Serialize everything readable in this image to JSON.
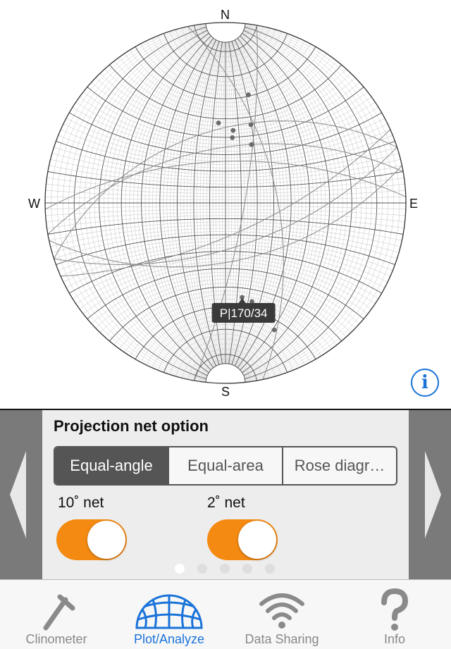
{
  "stereonet": {
    "directions": {
      "north": "N",
      "south": "S",
      "east": "E",
      "west": "W"
    },
    "tooltip": "P|170/34",
    "poles": [
      {
        "trend": 170,
        "plunge": 34
      },
      {
        "trend": 159,
        "plunge": 16
      },
      {
        "trend": 159,
        "plunge": 23
      },
      {
        "trend": 162,
        "plunge": 23
      },
      {
        "trend": 165,
        "plunge": 31
      },
      {
        "trend": 355,
        "plunge": 42
      },
      {
        "trend": 18,
        "plunge": 41
      },
      {
        "trend": 24,
        "plunge": 51
      },
      {
        "trend": 6,
        "plunge": 46
      },
      {
        "trend": 6,
        "plunge": 50
      },
      {
        "trend": 12,
        "plunge": 27
      }
    ],
    "planes": [
      {
        "strike": 72,
        "dip": 62
      },
      {
        "strike": 66,
        "dip": 70
      },
      {
        "strike": 78,
        "dip": 54
      },
      {
        "strike": 252,
        "dip": 46
      },
      {
        "strike": 260,
        "dip": 56
      },
      {
        "strike": 268,
        "dip": 64
      },
      {
        "strike": 348,
        "dip": 58
      },
      {
        "strike": 10,
        "dip": 78
      }
    ],
    "colors": {
      "grid": "#bdbdbd",
      "major_grid": "#555555",
      "planes": "#8a8a8a",
      "poles": "#6a6a6a",
      "outline": "#333333"
    }
  },
  "info_button": {
    "glyph": "i",
    "icon": "info-icon"
  },
  "options": {
    "title": "Projection net option",
    "segments": [
      {
        "label": "Equal-angle",
        "active": true
      },
      {
        "label": "Equal-area",
        "active": false
      },
      {
        "label": "Rose diagr…",
        "active": false
      }
    ],
    "toggles": [
      {
        "label": "10˚ net",
        "on": true
      },
      {
        "label": "2˚ net",
        "on": true
      }
    ],
    "page_count": 5,
    "current_page": 0,
    "accent": "#f58a12"
  },
  "tabs": [
    {
      "label": "Clinometer",
      "icon": "clinometer-icon",
      "active": false
    },
    {
      "label": "Plot/Analyze",
      "icon": "stereonet-icon",
      "active": true
    },
    {
      "label": "Data Sharing",
      "icon": "wifi-icon",
      "active": false
    },
    {
      "label": "Info",
      "icon": "question-icon",
      "active": false
    }
  ],
  "colors": {
    "tab_active": "#1a73d9",
    "tab_inactive": "#888888",
    "panel_side": "#7a7a7a"
  }
}
